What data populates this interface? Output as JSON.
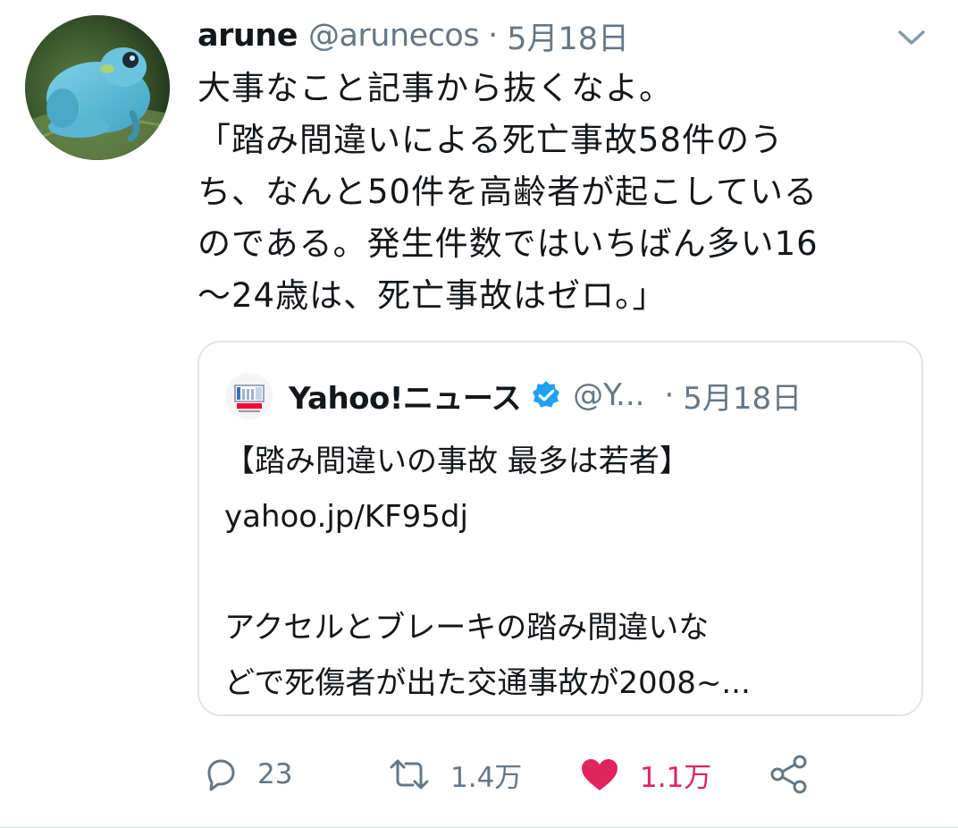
{
  "tweet": {
    "author": {
      "display_name": "arune",
      "handle": "@arunecos",
      "separator": "·",
      "date": "5月18日"
    },
    "body_lines": [
      "大事なこと記事から抜くなよ。",
      "「踏み間違いによる死亡事故58件のう",
      "ち、なんと50件を高齢者が起こしている",
      "のである。発生件数ではいちばん多い16",
      "〜24歳は、死亡事故はゼロ。」"
    ],
    "quoted": {
      "display_name": "Yahoo!ニュース",
      "handle": "@Y...",
      "separator": "·",
      "date": "5月18日",
      "lines": [
        "【踏み間違いの事故 最多は若者】",
        "yahoo.jp/KF95dj",
        "",
        "アクセルとブレーキの踏み間違いな",
        "どで死傷者が出た交通事故が2008~..."
      ]
    },
    "actions": {
      "reply_count": "23",
      "retweet_count": "1.4万",
      "like_count": "1.1万"
    },
    "colors": {
      "text": "#14171a",
      "secondary": "#657786",
      "like": "#e0245e",
      "verified": "#1da1f2",
      "border": "#dfe4e8"
    },
    "icons": {
      "caret": "chevron-down-icon",
      "reply": "reply-icon",
      "retweet": "retweet-icon",
      "like": "heart-icon",
      "share": "share-icon",
      "verified": "verified-badge-icon"
    }
  }
}
